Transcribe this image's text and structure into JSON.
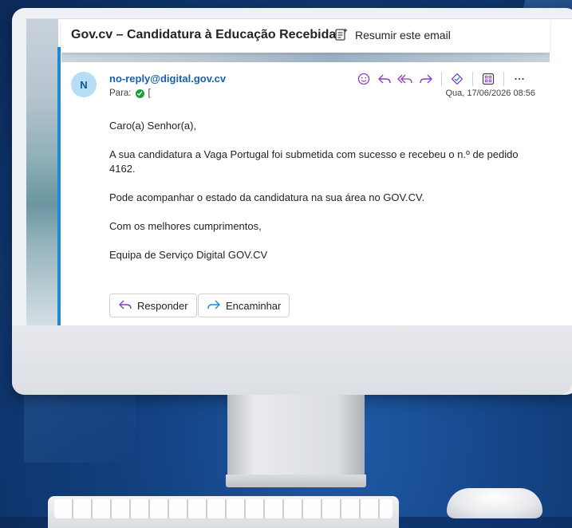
{
  "email": {
    "subject": "Gov.cv – Candidatura à Educação Recebida",
    "summarize_label": "Resumir este email",
    "avatar_initial": "N",
    "sender": "no-reply@digital.gov.cv",
    "to_label": "Para:",
    "recipient": "[",
    "date": "Qua, 17/06/2026 08:56",
    "body": {
      "greeting": "Caro(a) Senhor(a),",
      "paragraph1": "A sua candidatura a Vaga Portugal foi submetida com sucesso e recebeu o n.º de pedido 4162.",
      "paragraph2": "Pode acompanhar o estado da candidatura na sua área no GOV.CV.",
      "closing": "Com os melhores cumprimentos,",
      "signature": "Equipa de Serviço Digital GOV.CV"
    },
    "reply_label": "Responder",
    "forward_label": "Encaminhar",
    "toolbar_icons": [
      "emoji-icon",
      "reply-icon",
      "reply-all-icon",
      "forward-icon",
      "immersive-reader-icon",
      "apps-icon",
      "more-icon"
    ]
  },
  "colors": {
    "accent": "#1c8ad6",
    "sender_link": "#1a5fa8",
    "icon_purple": "#8a3fbf",
    "avatar_bg": "#b7dcf6"
  }
}
